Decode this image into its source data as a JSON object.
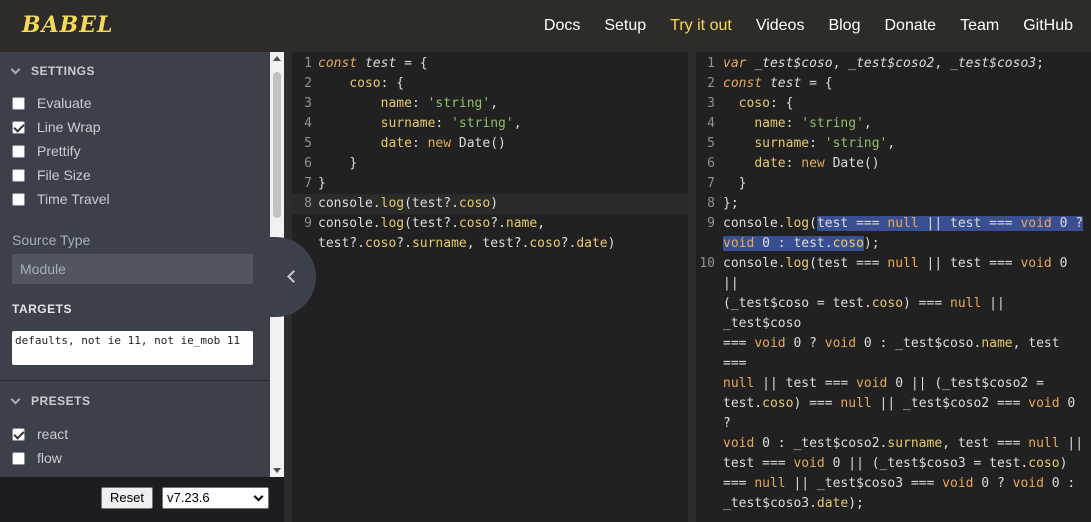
{
  "brand": {
    "logo": "BABEL",
    "accent": "#f5da55"
  },
  "nav": {
    "items": [
      "Docs",
      "Setup",
      "Try it out",
      "Videos",
      "Blog",
      "Donate",
      "Team",
      "GitHub"
    ],
    "active": "Try it out"
  },
  "sidebar": {
    "settings_title": "SETTINGS",
    "settings": [
      {
        "label": "Evaluate",
        "checked": false
      },
      {
        "label": "Line Wrap",
        "checked": true
      },
      {
        "label": "Prettify",
        "checked": false
      },
      {
        "label": "File Size",
        "checked": false
      },
      {
        "label": "Time Travel",
        "checked": false
      }
    ],
    "source_type_label": "Source Type",
    "source_type_value": "Module",
    "targets_title": "TARGETS",
    "targets_value": "defaults, not ie 11, not ie_mob 11",
    "presets_title": "PRESETS",
    "presets": [
      {
        "label": "react",
        "checked": true
      },
      {
        "label": "flow",
        "checked": false
      }
    ],
    "reset_label": "Reset",
    "version": "v7.23.6"
  },
  "input_editor": {
    "lines": [
      "1",
      "2",
      "3",
      "4",
      "5",
      "6",
      "7",
      "8",
      "9"
    ]
  },
  "output_editor": {
    "lines": [
      "1",
      "2",
      "3",
      "4",
      "5",
      "6",
      "7",
      "8",
      "9",
      "10"
    ]
  }
}
